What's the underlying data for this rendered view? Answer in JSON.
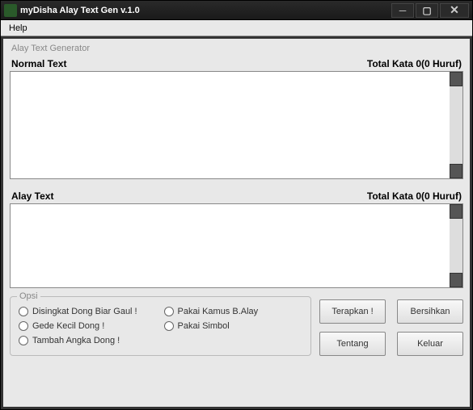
{
  "window": {
    "title": "myDisha Alay Text Gen v.1.0"
  },
  "menu": {
    "help": "Help"
  },
  "group": {
    "title": "Alay Text Generator"
  },
  "normal": {
    "label": "Normal Text",
    "stats": "Total Kata 0(0 Huruf)",
    "value": ""
  },
  "alay": {
    "label": "Alay Text",
    "stats": "Total Kata 0(0 Huruf)",
    "value": ""
  },
  "opsi": {
    "legend": "Opsi",
    "items": [
      "Disingkat Dong Biar Gaul !",
      "Pakai Kamus B.Alay",
      "Gede Kecil Dong !",
      "Pakai Simbol",
      "Tambah Angka Dong !"
    ]
  },
  "buttons": {
    "terapkan": "Terapkan !",
    "bersihkan": "Bersihkan",
    "tentang": "Tentang",
    "keluar": "Keluar"
  }
}
